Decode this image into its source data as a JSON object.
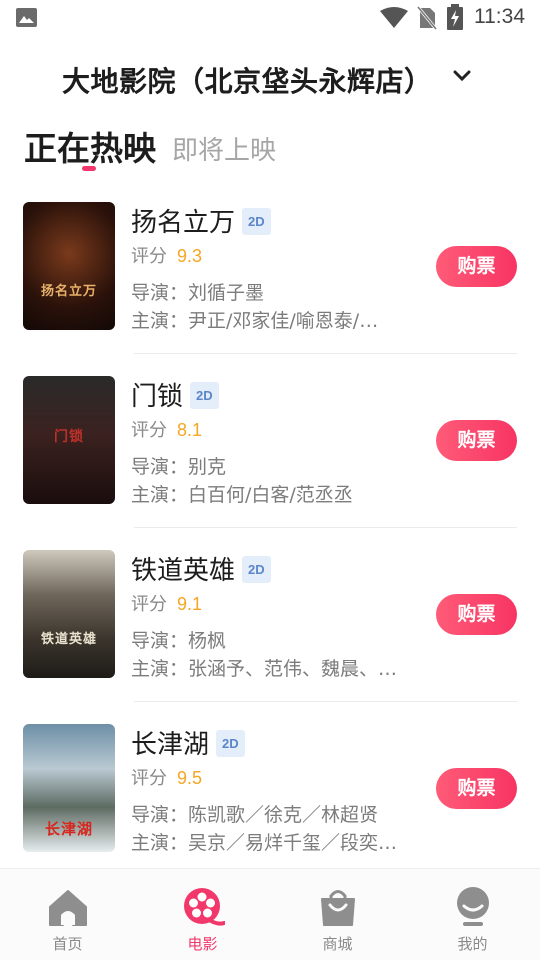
{
  "status_bar": {
    "time": "11:34"
  },
  "cinema": {
    "name": "大地影院（北京垡头永辉店）"
  },
  "tabs": {
    "now_showing": "正在热映",
    "coming_soon": "即将上映"
  },
  "movies": [
    {
      "title": "扬名立万",
      "format": "2D",
      "score_label": "评分",
      "score": "9.3",
      "director": "导演：刘循子墨",
      "cast": "主演：尹正/邓家佳/喻恩泰/…",
      "buy_label": "购票",
      "poster_text": "扬名立万"
    },
    {
      "title": "门锁",
      "format": "2D",
      "score_label": "评分",
      "score": "8.1",
      "director": "导演：别克",
      "cast": "主演：白百何/白客/范丞丞",
      "buy_label": "购票",
      "poster_text": "门锁"
    },
    {
      "title": "铁道英雄",
      "format": "2D",
      "score_label": "评分",
      "score": "9.1",
      "director": "导演：杨枫",
      "cast": "主演：张涵予、范伟、魏晨、…",
      "buy_label": "购票",
      "poster_text": "铁道英雄"
    },
    {
      "title": "长津湖",
      "format": "2D",
      "score_label": "评分",
      "score": "9.5",
      "director": "导演：陈凯歌／徐克／林超贤",
      "cast": "主演：吴京／易烊千玺／段奕…",
      "buy_label": "购票",
      "poster_text": "长津湖"
    }
  ],
  "bottom_nav": [
    {
      "label": "首页",
      "icon": "home-icon"
    },
    {
      "label": "电影",
      "icon": "film-reel-icon",
      "active": true
    },
    {
      "label": "商城",
      "icon": "shopping-bag-icon"
    },
    {
      "label": "我的",
      "icon": "profile-icon"
    }
  ],
  "colors": {
    "accent": "#f2386a",
    "score": "#f5a623",
    "badge": "#5b86c9"
  }
}
